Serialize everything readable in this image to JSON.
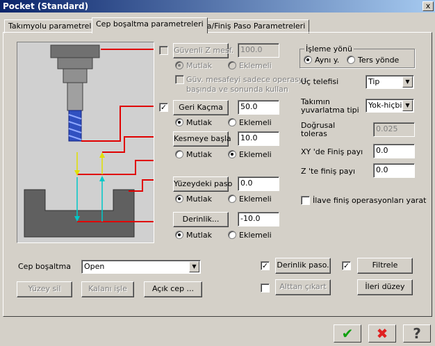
{
  "window": {
    "title": "Pocket (Standard)",
    "close": "x"
  },
  "tabs": [
    {
      "label": "Takımyolu parametreleri"
    },
    {
      "label": "Cep boşaltma parametreleri"
    },
    {
      "label": "Kaba/Finiş Paso Parametreleri"
    }
  ],
  "clearance": {
    "button": "Güvenli Z mesf.",
    "value": "100.0",
    "absolute": "Mutlak",
    "incremental": "Eklemeli",
    "only_start_end_line1": "Güv. mesafeyi sadece operasyc",
    "only_start_end_line2": "başında ve sonunda kullan"
  },
  "retract": {
    "button": "Geri Kaçma",
    "value": "50.0",
    "absolute": "Mutlak",
    "incremental": "Eklemeli"
  },
  "feed_plane": {
    "button": "Kesmeye başla",
    "value": "10.0",
    "absolute": "Mutlak",
    "incremental": "Eklemeli"
  },
  "top_of_stock": {
    "button": "Yüzeydeki paso",
    "value": "0.0",
    "absolute": "Mutlak",
    "incremental": "Eklemeli"
  },
  "depth": {
    "button": "Derinlik...",
    "value": "-10.0",
    "absolute": "Mutlak",
    "incremental": "Eklemeli"
  },
  "machining_direction": {
    "label": "İşleme yönü",
    "climb": "Aynı y.",
    "conventional": "Ters yönde"
  },
  "tip_comp": {
    "label": "Uç telefisi",
    "value": "Tip"
  },
  "roll_cutter": {
    "label_line1": "Takımın",
    "label_line2": "yuvarlatma tipi",
    "value": "Yok-hiçbiri"
  },
  "linear_tolerance": {
    "label_line1": "Doğrusal",
    "label_line2": "toleras",
    "value": "0.025"
  },
  "xy_stock": {
    "label": "XY 'de Finiş payı",
    "value": "0.0"
  },
  "z_stock": {
    "label": "Z 'te finiş payı",
    "value": "0.0"
  },
  "extra_finish": {
    "label": "İlave finiş operasyonları yarat"
  },
  "pocket_type": {
    "label": "Cep boşaltma",
    "value": "Open"
  },
  "bottom_buttons": {
    "facing": "Yüzey sil",
    "remachining": "Kalanı işle",
    "open_pocket": "Açık cep ...",
    "depth_cuts": "Derinlik paso.",
    "island_facing": "Alttan çıkart",
    "filter": "Filtrele",
    "advanced": "İleri düzey"
  },
  "footer": {
    "ok_icon": "check-icon",
    "cancel_icon": "x-icon",
    "help_icon": "question-icon",
    "ok": "✔",
    "cancel": "✖",
    "help": "?"
  },
  "colors": {
    "title_start": "#0a246a",
    "title_end": "#a6caf0",
    "leader_red": "#e00000",
    "arrow_yellow": "#e0e000",
    "arrow_cyan": "#00c8c8"
  }
}
